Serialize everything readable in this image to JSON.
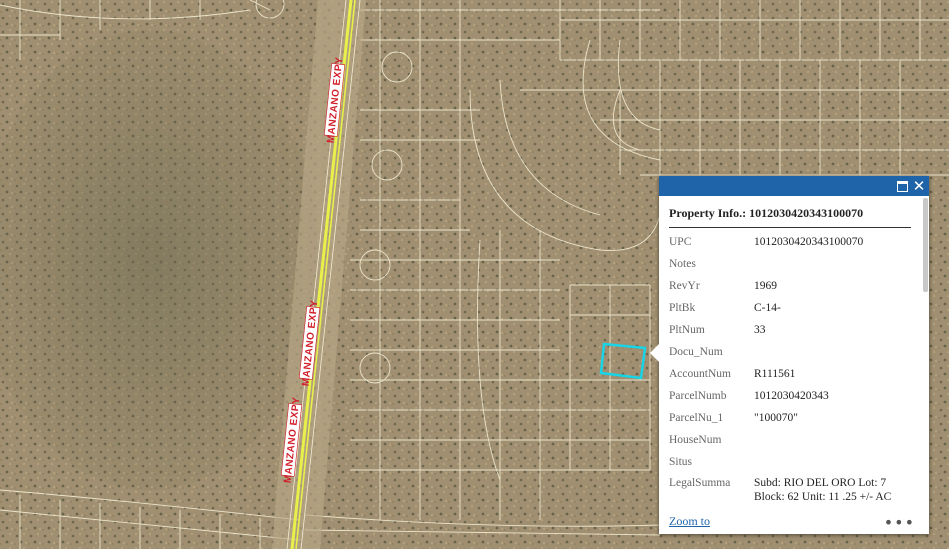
{
  "map": {
    "road_name": "MANZANO EXPY",
    "colors": {
      "terrain": "#9a8a6c",
      "parcel_lines": "#f3edd4",
      "road_line": "#e8f04a",
      "highlight": "#17d4e6"
    }
  },
  "popup": {
    "title": "Property Info.: 1012030420343100070",
    "fields": [
      {
        "key": "UPC",
        "value": "1012030420343100070"
      },
      {
        "key": "Notes",
        "value": ""
      },
      {
        "key": "RevYr",
        "value": "1969"
      },
      {
        "key": "PltBk",
        "value": "C-14-"
      },
      {
        "key": "PltNum",
        "value": "33"
      },
      {
        "key": "Docu_Num",
        "value": ""
      },
      {
        "key": "AccountNum",
        "value": "R111561"
      },
      {
        "key": "ParcelNumb",
        "value": "1012030420343"
      },
      {
        "key": "ParcelNu_1",
        "value": "\"100070\""
      },
      {
        "key": "HouseNum",
        "value": ""
      },
      {
        "key": "Situs",
        "value": ""
      },
      {
        "key": "LegalSumma",
        "value": "Subd: RIO DEL ORO Lot: 7 Block: 62 Unit: 11 .25 +/- AC"
      }
    ],
    "zoom_label": "Zoom to",
    "more_label": "•••",
    "icons": {
      "maximize": "maximize-icon",
      "close": "close-icon"
    }
  }
}
